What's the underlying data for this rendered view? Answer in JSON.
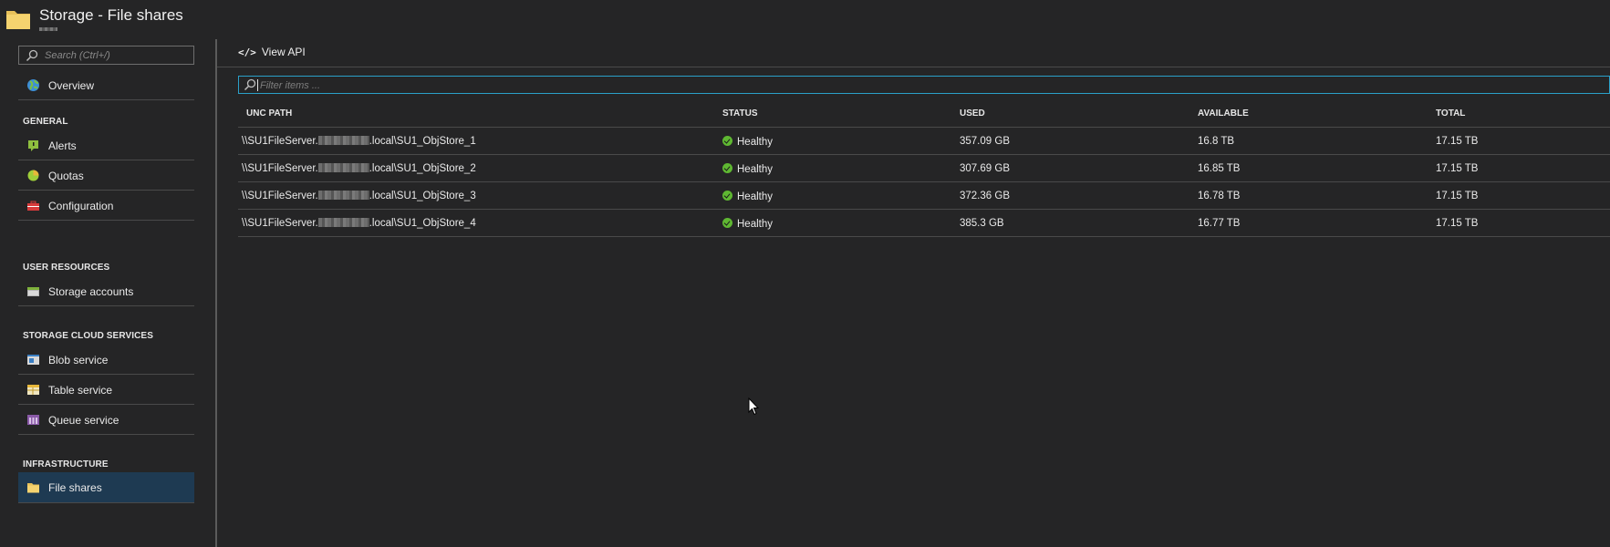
{
  "header": {
    "title": "Storage - File shares",
    "icon": "folder-icon"
  },
  "sidebar": {
    "search_placeholder": "Search (Ctrl+/)",
    "overview": {
      "label": "Overview",
      "icon": "globe-icon"
    },
    "sections": [
      {
        "heading": "GENERAL",
        "items": [
          {
            "label": "Alerts",
            "icon": "alert-icon"
          },
          {
            "label": "Quotas",
            "icon": "pie-chart-icon"
          },
          {
            "label": "Configuration",
            "icon": "toolbox-icon"
          }
        ]
      },
      {
        "heading": "USER RESOURCES",
        "items": [
          {
            "label": "Storage accounts",
            "icon": "storage-account-icon"
          }
        ]
      },
      {
        "heading": "STORAGE CLOUD SERVICES",
        "items": [
          {
            "label": "Blob service",
            "icon": "blob-icon"
          },
          {
            "label": "Table service",
            "icon": "table-icon"
          },
          {
            "label": "Queue service",
            "icon": "queue-icon"
          }
        ]
      },
      {
        "heading": "INFRASTRUCTURE",
        "items": [
          {
            "label": "File shares",
            "icon": "folder-icon",
            "selected": true
          }
        ]
      }
    ]
  },
  "toolbar": {
    "view_api_label": "View API",
    "view_api_icon": "code-icon"
  },
  "filter": {
    "placeholder": "Filter items ..."
  },
  "grid": {
    "columns": [
      "UNC PATH",
      "STATUS",
      "USED",
      "AVAILABLE",
      "TOTAL"
    ],
    "rows": [
      {
        "path_prefix": "\\\\SU1FileServer.",
        "path_suffix": ".local\\SU1_ObjStore_1",
        "status": "Healthy",
        "used": "357.09 GB",
        "available": "16.8 TB",
        "total": "17.15 TB"
      },
      {
        "path_prefix": "\\\\SU1FileServer.",
        "path_suffix": ".local\\SU1_ObjStore_2",
        "status": "Healthy",
        "used": "307.69 GB",
        "available": "16.85 TB",
        "total": "17.15 TB"
      },
      {
        "path_prefix": "\\\\SU1FileServer.",
        "path_suffix": ".local\\SU1_ObjStore_3",
        "status": "Healthy",
        "used": "372.36 GB",
        "available": "16.78 TB",
        "total": "17.15 TB"
      },
      {
        "path_prefix": "\\\\SU1FileServer.",
        "path_suffix": ".local\\SU1_ObjStore_4",
        "status": "Healthy",
        "used": "385.3 GB",
        "available": "16.77 TB",
        "total": "17.15 TB"
      }
    ]
  },
  "colors": {
    "background": "#252526",
    "accent": "#2aa0c8",
    "selected": "#1e3a52",
    "healthy": "#5fb832"
  }
}
